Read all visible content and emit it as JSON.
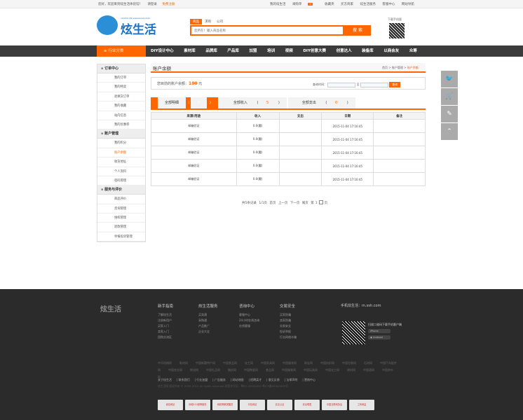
{
  "topbar": {
    "welcome": "您好，欢迎来到炫生活体验馆！",
    "login": "请登录",
    "register": "免费注册",
    "right": [
      "我的炫生活",
      "采购单",
      "0",
      "收藏夹",
      "买方商家",
      "炫生活服务",
      "客服中心",
      "网站导航"
    ]
  },
  "header": {
    "logo_text": "炫生活",
    "logo_tagline": "colorful life experience mall",
    "search_tabs": [
      "商品",
      "求购",
      "公司"
    ],
    "search_placeholder": "您所在！输入商品名称",
    "search_button": "搜 索",
    "qr_label": "下载手机版"
  },
  "nav": {
    "category": "行业分类",
    "items": [
      "DIY设计中心",
      "素材库",
      "品牌库",
      "产品库",
      "加盟",
      "培训",
      "视频",
      "DIY创意大赛",
      "创意达人",
      "装备库",
      "以商会友",
      "众筹"
    ]
  },
  "sidebar": {
    "groups": [
      {
        "title": "订单中心",
        "items": [
          "我的订单",
          "我的特卖",
          "退换货订单",
          "我的收藏",
          "站内信息",
          "我的优惠券"
        ]
      },
      {
        "title": "账户管理",
        "items": [
          "我的积分",
          "账户余额",
          "收货地址",
          "个人资料",
          "密码管理"
        ]
      },
      {
        "title": "服务与评价",
        "items": [
          "商品评价",
          "咨询管理",
          "维权管理",
          "退款管理",
          "举报投诉管理"
        ]
      }
    ],
    "active": "账户余额"
  },
  "main": {
    "title": "账户余额",
    "breadcrumb": [
      "首页",
      "账户管理",
      "账户余额"
    ],
    "balance_label": "您目前的账户余额：",
    "balance_value": "100",
    "balance_unit": "元",
    "query_label": "查询时间：",
    "query_to": "至",
    "query_button": "查询",
    "tabs": [
      {
        "label": "全部明细",
        "count": "5"
      },
      {
        "label": "全部收入",
        "count": "5"
      },
      {
        "label": "全部支出",
        "count": "0"
      }
    ],
    "table": {
      "headers": [
        "来源/用途",
        "收入",
        "支出",
        "日期",
        "备注"
      ],
      "rows": [
        [
          "邮箱验证",
          "0.0(魔)",
          "",
          "2015-11-04 17:16:45",
          ""
        ],
        [
          "邮箱验证",
          "0.0(魔)",
          "",
          "2015-11-04 17:16:45",
          ""
        ],
        [
          "邮箱验证",
          "0.0(魔)",
          "",
          "2015-11-04 17:16:45",
          ""
        ],
        [
          "邮箱验证",
          "0.0(魔)",
          "",
          "2015-11-04 17:16:45",
          ""
        ],
        [
          "邮箱验证",
          "0.0(魔)",
          "",
          "2015-11-04 17:16:45",
          ""
        ]
      ]
    },
    "pager": {
      "total": "共5条记录",
      "pages": "1/1页",
      "first": "首页",
      "prev": "上一页",
      "next": "下一页",
      "last": "尾页",
      "goto": "第",
      "page_num": "1",
      "unit": "页"
    }
  },
  "footer": {
    "logo": "炫生活",
    "cols": [
      {
        "title": "新手指南",
        "items": [
          "了解炫生活",
          "注册新用户",
          "买家入门",
          "卖家入门",
          "团购交流区"
        ]
      },
      {
        "title": "炫生活服务",
        "items": [
          "买卖通",
          "采购通",
          "产品推广",
          "企业大全"
        ]
      },
      {
        "title": "咨询中心",
        "items": [
          "客服中心",
          "24小时在线咨询",
          "在线客服"
        ]
      },
      {
        "title": "交易安全",
        "items": [
          "买家防骗",
          "卖家防骗",
          "交易安全",
          "投诉举报",
          "打击网络诈骗"
        ]
      }
    ],
    "mobile_title": "手机炫生活：m.xsh.com",
    "mobile_text": "扫描二维码下载手机客户端",
    "apps": [
      "iPhone",
      "Android"
    ],
    "links": [
      "中华机械网",
      "鞋材网",
      "中国新疆特产网",
      "中国食品网",
      "化工网",
      "中国家具网",
      "中国服装网",
      "珠宝网",
      "中国纺织网",
      "中国包装网",
      "石材网",
      "中国汽车配件网",
      "中国农业网",
      "物流网",
      "中国礼品网",
      "婚庆网",
      "中国陶瓷网",
      "食品网",
      "中国服装网",
      "中国玩具网",
      "中国化工网",
      "建材网",
      "中国酒网",
      "中国茶叶网"
    ],
    "bottom": [
      "关于炫生活",
      "联系我们",
      "行业加盟",
      "广告服务",
      "网站地图",
      "招聘英才",
      "意见反馈",
      "法律声明",
      "营销中心"
    ],
    "copyright": "炫生活网 版权所有 © 2005-2015 All rights reserved  经营许可证：粤B2-20050000  粤ICP备05000000号"
  },
  "badges": [
    "诚信网站",
    "网络110报警服务",
    "网络警察提醒您",
    "可信网站",
    "实名认证",
    "安全联盟",
    "中国互联网协会",
    "工商网监"
  ]
}
